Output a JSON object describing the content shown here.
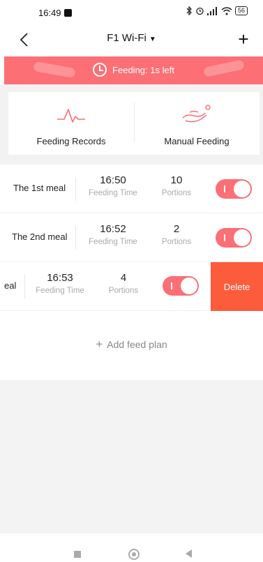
{
  "status_bar": {
    "time": "16:49",
    "battery": "56"
  },
  "nav": {
    "title": "F1 Wi-Fi",
    "caret": "▼",
    "add_glyph": "+"
  },
  "banner": {
    "text": "Feeding: 1s left",
    "color": "#fb6f75"
  },
  "quick_actions": [
    {
      "label": "Feeding Records",
      "icon": "pulse-icon"
    },
    {
      "label": "Manual Feeding",
      "icon": "hand-feeding-icon"
    }
  ],
  "meals": [
    {
      "name": "The 1st meal",
      "time": "16:50",
      "time_label": "Feeding Time",
      "portions": "10",
      "portions_label": "Portions",
      "enabled": true
    },
    {
      "name": "The 2nd meal",
      "time": "16:52",
      "time_label": "Feeding Time",
      "portions": "2",
      "portions_label": "Portions",
      "enabled": true
    },
    {
      "name": "eal",
      "time": "16:53",
      "time_label": "Feeding Time",
      "portions": "4",
      "portions_label": "Portions",
      "enabled": true,
      "delete_label": "Delete"
    }
  ],
  "add_plan": {
    "plus": "+",
    "label": "Add feed plan"
  },
  "colors": {
    "accent": "#fb6f75",
    "delete": "#fc5b3c"
  }
}
